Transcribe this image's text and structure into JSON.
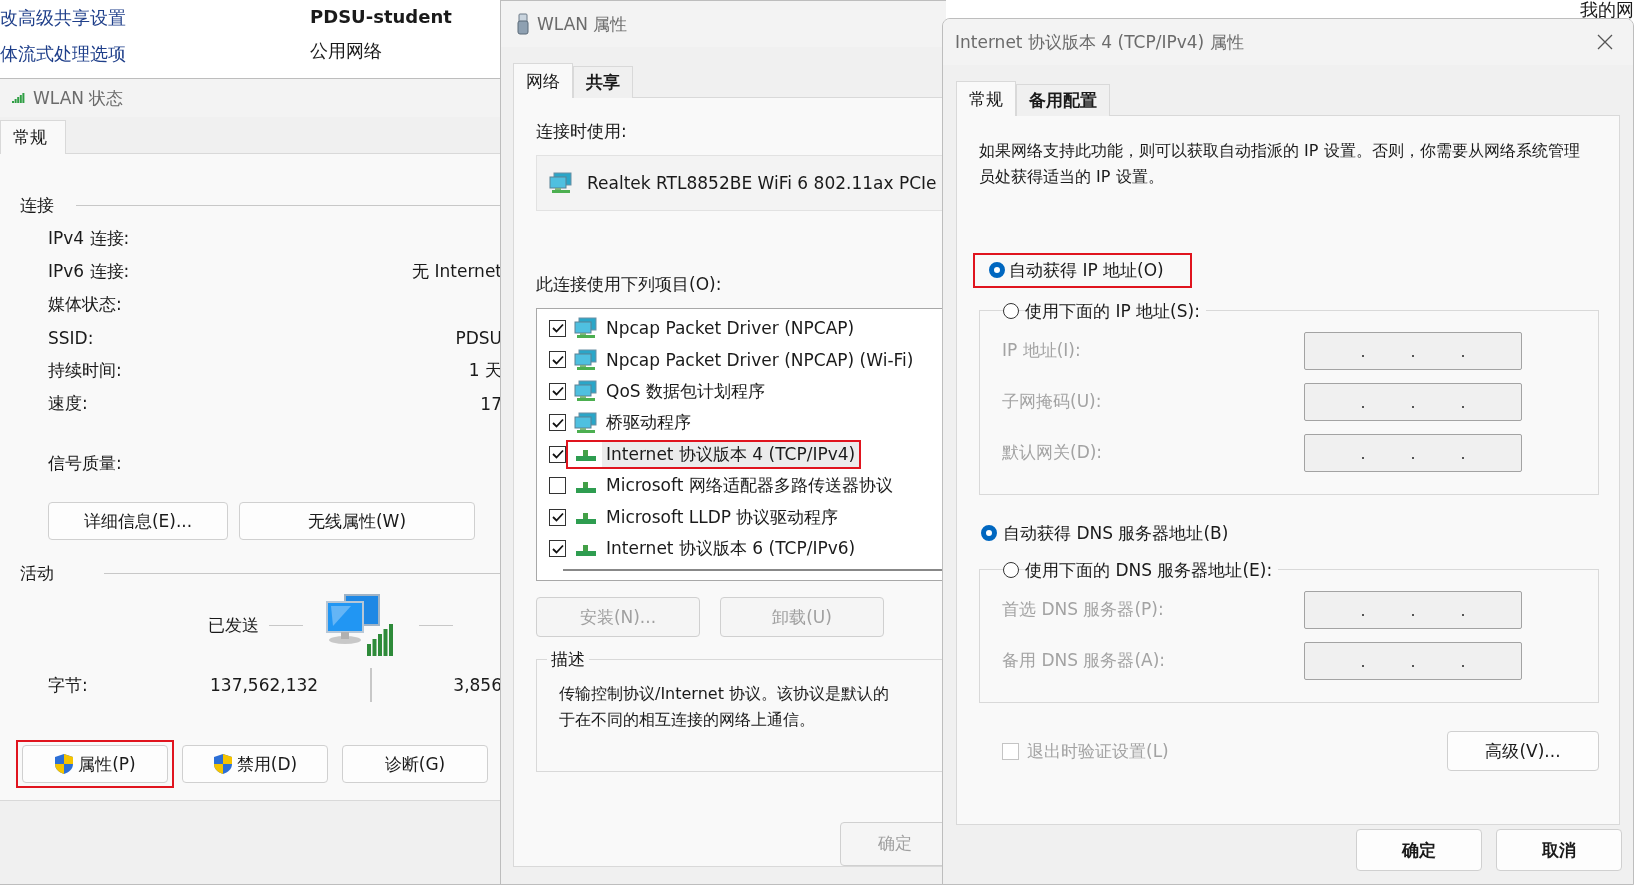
{
  "background": {
    "links": [
      "改高级共享设置",
      "体流式处理选项"
    ],
    "network_name": "PDSU-student",
    "network_type": "公用网络",
    "corner_text": "我的网"
  },
  "status_window": {
    "title": "WLAN 状态",
    "tabs": [
      {
        "label": "常规",
        "selected": true
      }
    ],
    "connection": {
      "heading": "连接",
      "rows": [
        {
          "label": "IPv4 连接:"
        },
        {
          "label": "IPv6 连接:",
          "value": "无 Internet"
        },
        {
          "label": "媒体状态:"
        },
        {
          "label": "SSID:",
          "value": "PDSU"
        },
        {
          "label": "持续时间:",
          "value": "1 天"
        },
        {
          "label": "速度:",
          "value": "17"
        }
      ],
      "signal_label": "信号质量:",
      "buttons": [
        "详细信息(E)...",
        "无线属性(W)"
      ]
    },
    "activity": {
      "heading": "活动",
      "sent_label": "已发送",
      "bytes_label": "字节:",
      "bytes_sent": "137,562,132",
      "bytes_received": "3,856"
    },
    "buttons": [
      {
        "label": "属性(P)",
        "shield": true,
        "highlighted": true
      },
      {
        "label": "禁用(D)",
        "shield": true,
        "highlighted": false
      },
      {
        "label": "诊断(G)",
        "shield": false,
        "highlighted": false
      }
    ]
  },
  "properties_window": {
    "title": "WLAN 属性",
    "tabs": [
      {
        "label": "网络",
        "selected": true
      },
      {
        "label": "共享",
        "selected": false
      }
    ],
    "connect_using_label": "连接时使用:",
    "adapter": "Realtek RTL8852BE WiFi 6 802.11ax PCIe",
    "items_label": "此连接使用下列项目(O):",
    "items": [
      {
        "label": "Npcap Packet Driver (NPCAP)",
        "kind": "service",
        "checked": true,
        "selected": false,
        "highlighted": false
      },
      {
        "label": "Npcap Packet Driver (NPCAP) (Wi-Fi)",
        "kind": "service",
        "checked": true,
        "selected": false,
        "highlighted": false
      },
      {
        "label": "QoS 数据包计划程序",
        "kind": "service",
        "checked": true,
        "selected": false,
        "highlighted": false
      },
      {
        "label": "桥驱动程序",
        "kind": "service",
        "checked": true,
        "selected": false,
        "highlighted": false
      },
      {
        "label": "Internet 协议版本 4 (TCP/IPv4)",
        "kind": "protocol",
        "checked": true,
        "selected": true,
        "highlighted": true
      },
      {
        "label": "Microsoft 网络适配器多路传送器协议",
        "kind": "protocol",
        "checked": false,
        "selected": false,
        "highlighted": false
      },
      {
        "label": "Microsoft LLDP 协议驱动程序",
        "kind": "protocol",
        "checked": true,
        "selected": false,
        "highlighted": false
      },
      {
        "label": "Internet 协议版本 6 (TCP/IPv6)",
        "kind": "protocol",
        "checked": true,
        "selected": false,
        "highlighted": false
      }
    ],
    "buttons": [
      {
        "label": "安装(N)...",
        "disabled": true
      },
      {
        "label": "卸载(U)",
        "disabled": true
      }
    ],
    "description": {
      "heading": "描述",
      "lines": [
        "传输控制协议/Internet 协议。该协议是默认的",
        "于在不同的相互连接的网络上通信。"
      ]
    },
    "ok_button": {
      "label": "确定",
      "disabled": true
    }
  },
  "ipv4_window": {
    "title": "Internet 协议版本 4 (TCP/IPv4) 属性",
    "tabs": [
      {
        "label": "常规",
        "selected": true
      },
      {
        "label": "备用配置",
        "selected": false
      }
    ],
    "intro": "如果网络支持此功能，则可以获取自动指派的 IP 设置。否则，你需要从网络系统管理员处获得适当的 IP 设置。",
    "ip_options": [
      {
        "label": "自动获得 IP 地址(O)",
        "selected": true,
        "highlighted": true
      },
      {
        "label": "使用下面的 IP 地址(S):",
        "selected": false,
        "highlighted": false
      }
    ],
    "ip_fields": [
      {
        "label": "IP 地址(I):",
        "disabled": true
      },
      {
        "label": "子网掩码(U):",
        "disabled": true
      },
      {
        "label": "默认网关(D):",
        "disabled": true
      }
    ],
    "dns_options": [
      {
        "label": "自动获得 DNS 服务器地址(B)",
        "selected": true,
        "highlighted": false
      },
      {
        "label": "使用下面的 DNS 服务器地址(E):",
        "selected": false,
        "highlighted": false
      }
    ],
    "dns_fields": [
      {
        "label": "首选 DNS 服务器(P):",
        "disabled": true
      },
      {
        "label": "备用 DNS 服务器(A):",
        "disabled": true
      }
    ],
    "validate": {
      "label": "退出时验证设置(L)",
      "checked": false,
      "disabled": true
    },
    "advanced_button": "高级(V)...",
    "ok_button": "确定",
    "cancel_button": "取消"
  }
}
